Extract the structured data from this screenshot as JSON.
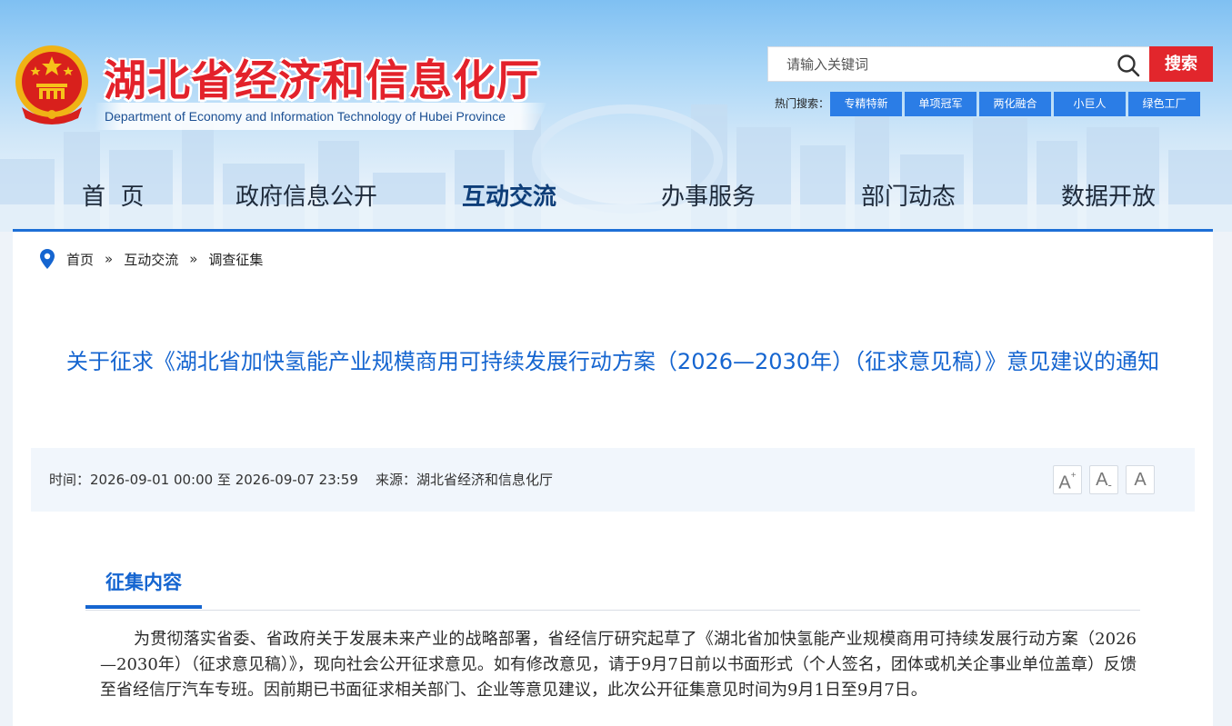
{
  "header": {
    "site_title": "湖北省经济和信息化厅",
    "site_subtitle": "Department of Economy and Information Technology of Hubei Province",
    "emblem_icon": "national-emblem-icon"
  },
  "search": {
    "placeholder": "请输入关键词",
    "button_label": "搜索",
    "hot_label": "热门搜索：",
    "hot_tags": [
      "专精特新",
      "单项冠军",
      "两化融合",
      "小巨人",
      "绿色工厂"
    ]
  },
  "nav": {
    "items": [
      "首  页",
      "政府信息公开",
      "互动交流",
      "办事服务",
      "部门动态",
      "数据开放"
    ],
    "active": "互动交流"
  },
  "breadcrumb": {
    "items": [
      "首页",
      "互动交流",
      "调查征集"
    ],
    "separator": "»"
  },
  "article": {
    "title": "关于征求《湖北省加快氢能产业规模商用可持续发展行动方案（2026—2030年）（征求意见稿）》意见建议的通知",
    "meta": "时间：2026-09-01 00:00 至 2026-09-07 23:59    来源：湖北省经济和信息化厅",
    "font_sizes": [
      "A",
      "A",
      "A"
    ],
    "section_label": "征集内容",
    "body": "为贯彻落实省委、省政府关于发展未来产业的战略部署，省经信厅研究起草了《湖北省加快氢能产业规模商用可持续发展行动方案（2026—2030年）（征求意见稿）》，现向社会公开征求意见。如有修改意见，请于9月7日前以书面形式（个人签名，团体或机关企事业单位盖章）反馈至省经信厅汽车专班。因前期已书面征求相关部门、企业等意见建议，此次公开征集意见时间为9月1日至9月7日。"
  },
  "colors": {
    "title_red": "#e3222b",
    "accent_blue": "#1565d0",
    "search_red": "#e2262c",
    "tag_blue": "#2b7de6"
  }
}
